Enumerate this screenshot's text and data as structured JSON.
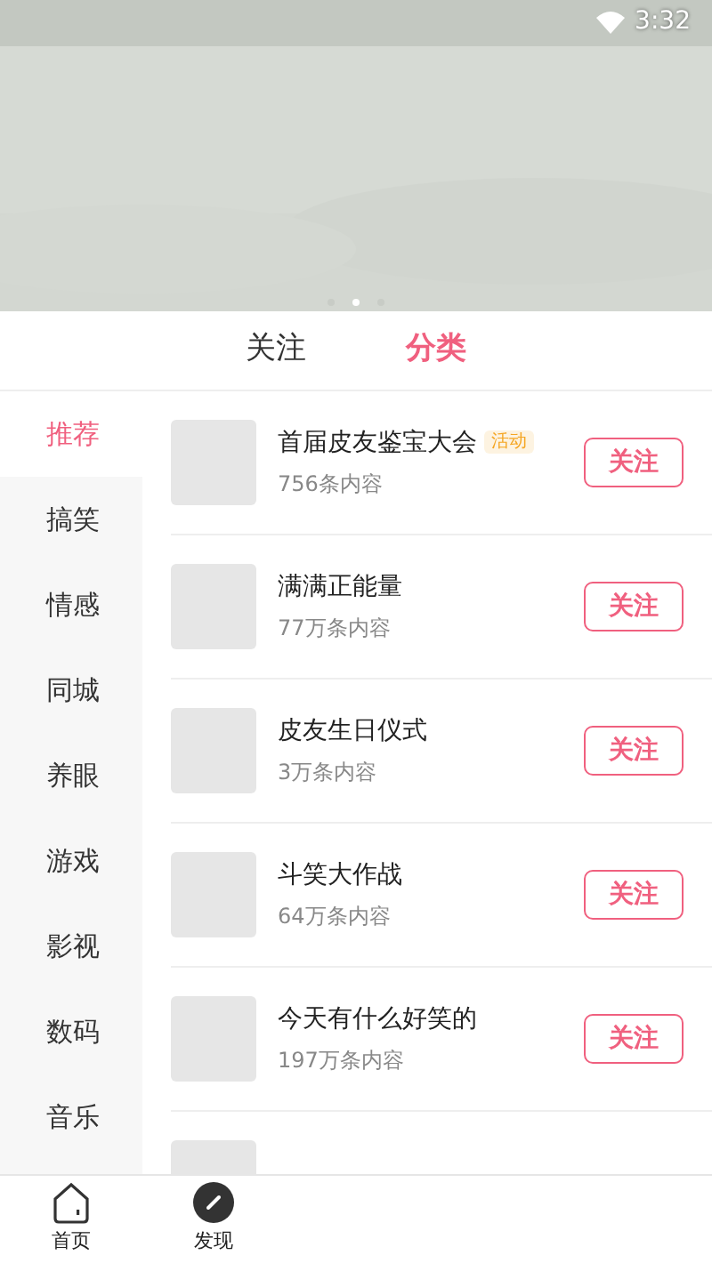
{
  "status_bar": {
    "time": "3:32"
  },
  "banner": {
    "dots": [
      {
        "selected": false
      },
      {
        "selected": true
      },
      {
        "selected": false
      }
    ]
  },
  "tabs": [
    {
      "label": "关注",
      "selected": false
    },
    {
      "label": "分类",
      "selected": true
    }
  ],
  "sidebar": {
    "items": [
      {
        "label": "推荐",
        "selected": true
      },
      {
        "label": "搞笑",
        "selected": false
      },
      {
        "label": "情感",
        "selected": false
      },
      {
        "label": "同城",
        "selected": false
      },
      {
        "label": "养眼",
        "selected": false
      },
      {
        "label": "游戏",
        "selected": false
      },
      {
        "label": "影视",
        "selected": false
      },
      {
        "label": "数码",
        "selected": false
      },
      {
        "label": "音乐",
        "selected": false
      }
    ]
  },
  "topics": [
    {
      "title": "首届皮友鉴宝大会",
      "tag": "活动",
      "count": "756条内容",
      "button": "关注"
    },
    {
      "title": "满满正能量",
      "count": "77万条内容",
      "button": "关注"
    },
    {
      "title": "皮友生日仪式",
      "count": "3万条内容",
      "button": "关注"
    },
    {
      "title": "斗笑大作战",
      "count": "64万条内容",
      "button": "关注"
    },
    {
      "title": "今天有什么好笑的",
      "count": "197万条内容",
      "button": "关注"
    }
  ],
  "bottom_nav": [
    {
      "label": "首页",
      "kind": "home"
    },
    {
      "label": "发现",
      "kind": "discover"
    }
  ]
}
